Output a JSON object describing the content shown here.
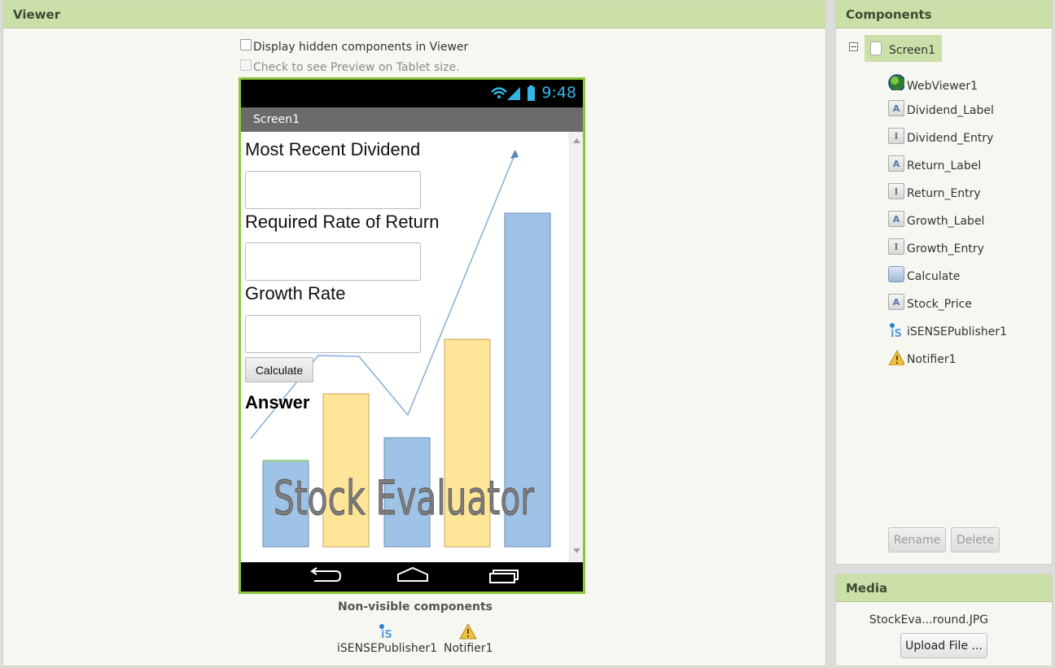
{
  "viewer": {
    "title": "Viewer",
    "checkbox_hidden_label": "Display hidden components in Viewer",
    "checkbox_tablet_label": "Check to see Preview on Tablet size.",
    "non_visible_title": "Non-visible components",
    "non_visible_items": [
      "iSENSEPublisher1",
      "Notifier1"
    ]
  },
  "phone": {
    "clock": "9:48",
    "screen_title": "Screen1",
    "labels": {
      "dividend": "Most Recent Dividend",
      "return": "Required Rate of Return",
      "growth": "Growth Rate",
      "answer": "Answer"
    },
    "calculate_button": "Calculate",
    "background_text": "Stock Evaluator"
  },
  "components": {
    "title": "Components",
    "root": "Screen1",
    "items": [
      {
        "name": "WebViewer1",
        "icon": "globe-icon"
      },
      {
        "name": "Dividend_Label",
        "icon": "label-icon"
      },
      {
        "name": "Dividend_Entry",
        "icon": "textbox-icon"
      },
      {
        "name": "Return_Label",
        "icon": "label-icon"
      },
      {
        "name": "Return_Entry",
        "icon": "textbox-icon"
      },
      {
        "name": "Growth_Label",
        "icon": "label-icon"
      },
      {
        "name": "Growth_Entry",
        "icon": "textbox-icon"
      },
      {
        "name": "Calculate",
        "icon": "button-icon"
      },
      {
        "name": "Stock_Price",
        "icon": "label-icon"
      },
      {
        "name": "iSENSEPublisher1",
        "icon": "isense-icon"
      },
      {
        "name": "Notifier1",
        "icon": "warning-icon"
      }
    ],
    "rename_button": "Rename",
    "delete_button": "Delete"
  },
  "media": {
    "title": "Media",
    "file": "StockEva...round.JPG",
    "upload_button": "Upload File ..."
  },
  "colors": {
    "panel_header": "#cbdfa8",
    "phone_border": "#8cc63f",
    "clock": "#33b5e5",
    "bar_blue": "#9fc3e7",
    "bar_yellow": "#ffe598"
  }
}
